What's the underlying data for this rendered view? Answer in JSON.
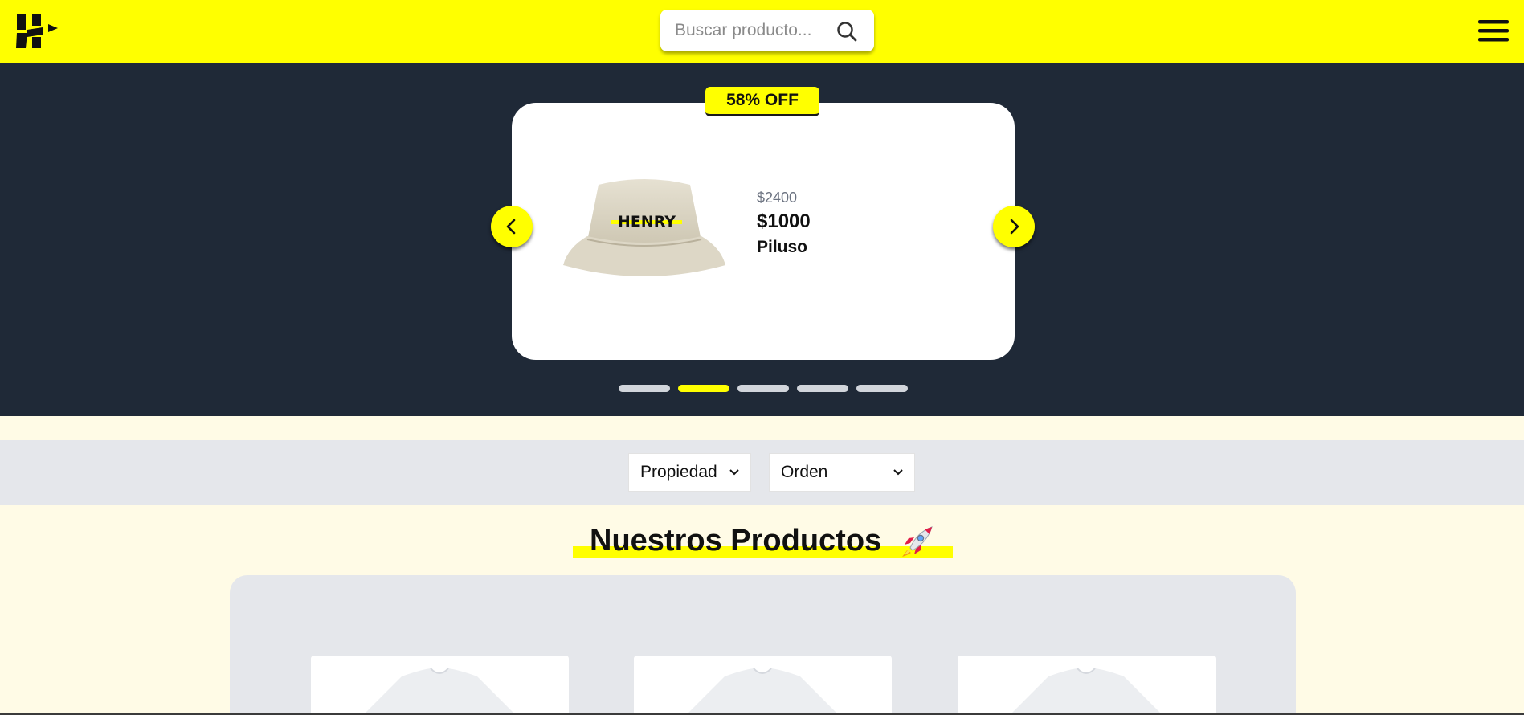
{
  "header": {
    "logo_icon": "henry-logo-icon",
    "search": {
      "placeholder": "Buscar producto...",
      "value": "",
      "icon": "search-icon"
    },
    "menu_icon": "hamburger-menu-icon"
  },
  "carousel": {
    "badge": "58% OFF",
    "product": {
      "image_icon": "bucket-hat-icon",
      "image_text": "HENRY",
      "old_price": "$2400",
      "price": "$1000",
      "name": "Piluso"
    },
    "prev_icon": "chevron-left-icon",
    "next_icon": "chevron-right-icon",
    "indicators": {
      "count": 5,
      "active_index": 1
    }
  },
  "filters": {
    "property": {
      "selected": "Propiedad"
    },
    "order": {
      "selected": "Orden"
    }
  },
  "products_section": {
    "title": "Nuestros Productos",
    "title_icon": "rocket-icon",
    "cards": [
      {
        "image_icon": "t-shirt-icon"
      },
      {
        "image_icon": "t-shirt-icon"
      },
      {
        "image_icon": "t-shirt-icon"
      }
    ]
  },
  "colors": {
    "accent": "#ffff00",
    "hero_background": "#1f2937",
    "page_background": "#fffbe6",
    "filter_background": "#e5e7eb",
    "indicator_inactive": "#d1d5db"
  }
}
